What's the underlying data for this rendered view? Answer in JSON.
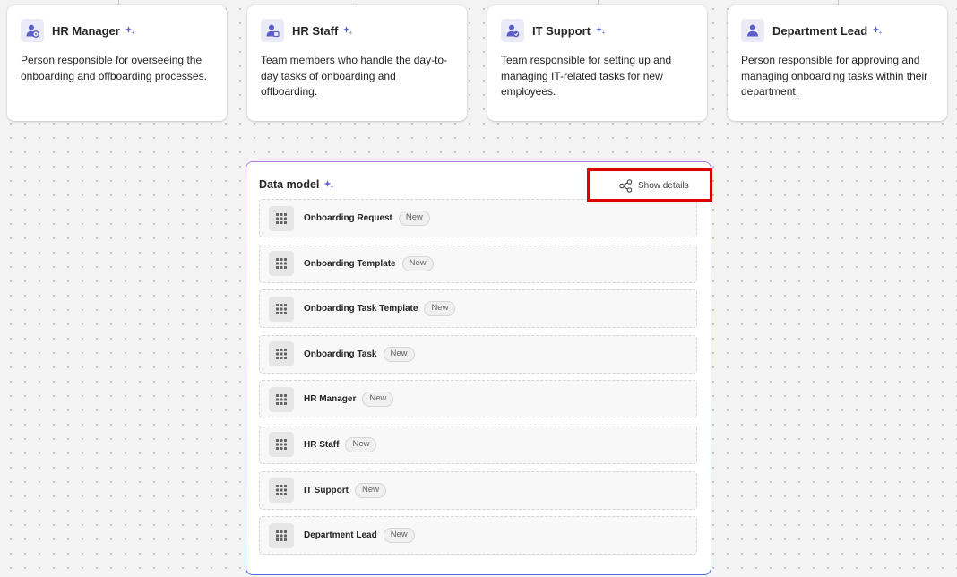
{
  "roles": [
    {
      "title": "HR Manager",
      "description": "Person responsible for overseeing the onboarding and offboarding processes."
    },
    {
      "title": "HR Staff",
      "description": "Team members who handle the day-to-day tasks of onboarding and offboarding."
    },
    {
      "title": "IT Support",
      "description": "Team responsible for setting up and managing IT-related tasks for new employees."
    },
    {
      "title": "Department Lead",
      "description": "Person responsible for approving and managing onboarding tasks within their department."
    }
  ],
  "data_model": {
    "title": "Data model",
    "show_details_label": "Show details",
    "entities": [
      {
        "name": "Onboarding Request",
        "badge": "New"
      },
      {
        "name": "Onboarding Template",
        "badge": "New"
      },
      {
        "name": "Onboarding Task Template",
        "badge": "New"
      },
      {
        "name": "Onboarding Task",
        "badge": "New"
      },
      {
        "name": "HR Manager",
        "badge": "New"
      },
      {
        "name": "HR Staff",
        "badge": "New"
      },
      {
        "name": "IT Support",
        "badge": "New"
      },
      {
        "name": "Department Lead",
        "badge": "New"
      }
    ]
  },
  "colors": {
    "accent": "#5b5fc7",
    "highlight_border": "#e00000",
    "panel_border_start": "#b77ce8",
    "panel_border_end": "#4f6bdc"
  }
}
